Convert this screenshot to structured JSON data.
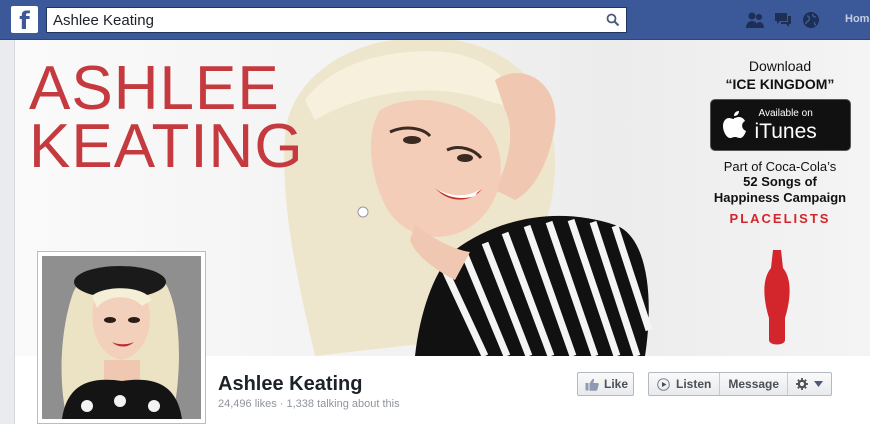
{
  "topbar": {
    "logo": "f",
    "search_value": "Ashlee Keating",
    "home_label": "Home",
    "colors": {
      "bar": "#3b5998"
    }
  },
  "cover": {
    "brand_line1": "ASHLEE",
    "brand_line2": "KEATING",
    "promo": {
      "download": "Download",
      "song": "“ICE KINGDOM”",
      "itunes_small": "Available on",
      "itunes_big": "iTunes",
      "part_of": "Part of Coca-Cola’s",
      "campaign_line1": "52 Songs of",
      "campaign_line2": "Happiness Campaign",
      "placelists": "PLACELISTS"
    },
    "colors": {
      "brand_red": "#c43a3f",
      "coke_red": "#d3262c"
    }
  },
  "page": {
    "name": "Ashlee Keating",
    "stats": "24,496 likes · 1,338 talking about this"
  },
  "actions": {
    "like": "Like",
    "listen": "Listen",
    "message": "Message"
  },
  "icons": [
    "facebook-logo-icon",
    "search-icon",
    "friend-requests-icon",
    "messages-icon",
    "notifications-globe-icon",
    "apple-icon",
    "like-thumb-icon",
    "play-icon",
    "gear-icon",
    "caret-down-icon"
  ]
}
